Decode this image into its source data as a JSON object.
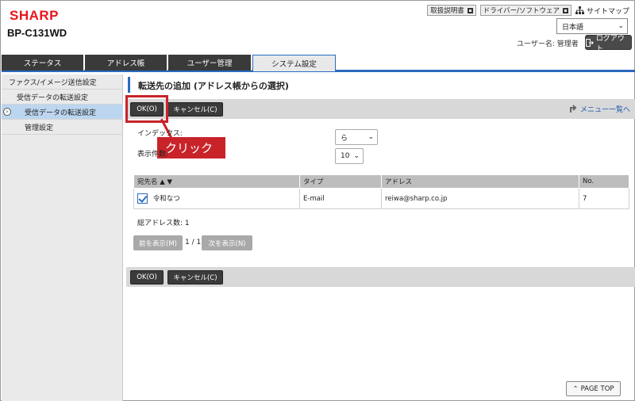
{
  "header": {
    "logo": "SHARP",
    "model": "BP-C131WD",
    "links": [
      "取扱説明書",
      "ドライバー/ソフトウェア"
    ],
    "sitemap": "サイトマップ",
    "language": "日本語",
    "user_label": "ユーザー名: 管理者",
    "logout": "ログアウト"
  },
  "tabs": [
    {
      "label": "ステータス"
    },
    {
      "label": "アドレス帳"
    },
    {
      "label": "ユーザー管理"
    },
    {
      "label": "システム設定"
    }
  ],
  "sidebar": {
    "items": [
      {
        "label": "ファクス/イメージ送信設定"
      },
      {
        "label": "受信データの転送設定"
      },
      {
        "label": "受信データの転送設定"
      },
      {
        "label": "管理設定"
      }
    ]
  },
  "main": {
    "title": "転送先の追加 (アドレス帳からの選択)",
    "ok": "OK(O)",
    "cancel": "キャンセル(C)",
    "menu_link": "メニュー一覧へ",
    "index_label": "インデックス:",
    "index_value": "ら",
    "count_label": "表示件数:",
    "count_value": "10",
    "callout": "クリック",
    "table": {
      "headers": [
        "宛先名 ▲ ▼",
        "タイプ",
        "アドレス",
        "No."
      ],
      "rows": [
        {
          "name": "令和なつ",
          "type": "E-mail",
          "address": "reiwa@sharp.co.jp",
          "no": "7"
        }
      ]
    },
    "total": "総アドレス数: 1",
    "prev": "前を表示(M)",
    "page": "1 / 1",
    "next": "次を表示(N)",
    "page_top": "PAGE TOP"
  },
  "colors": {
    "accent": "#2b6bbf",
    "brand": "#e8161b",
    "callout": "#c9232a"
  }
}
